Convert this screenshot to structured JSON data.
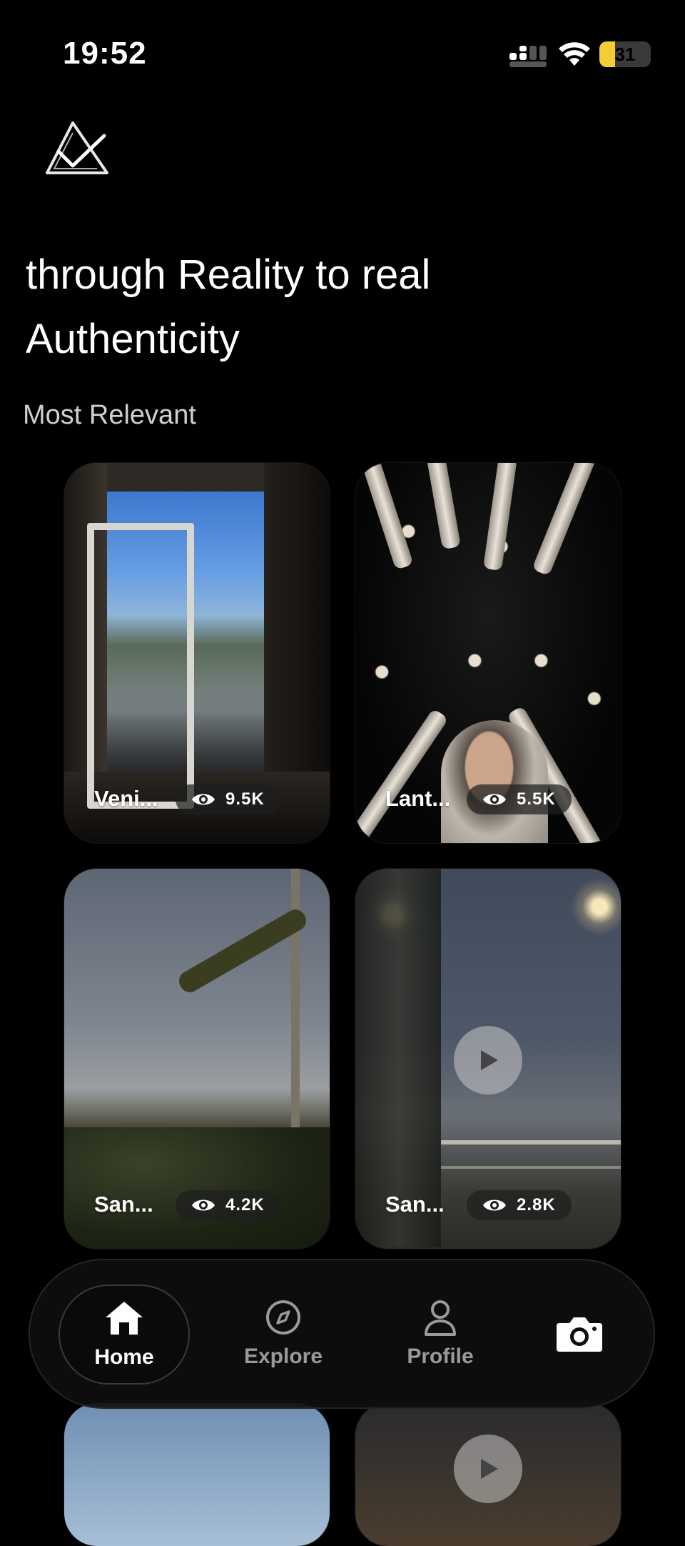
{
  "status_bar": {
    "time": "19:52",
    "battery_level": "31",
    "battery_fraction": 0.31,
    "icons": [
      "cellular-signal-icon",
      "wifi-icon",
      "battery-icon"
    ]
  },
  "header": {
    "logo": "app-logo",
    "headline_line1": "through Reality to real",
    "headline_line2": "Authenticity"
  },
  "section": {
    "title": "Most Relevant"
  },
  "cards": [
    {
      "label": "Veni...",
      "views": "9.5K",
      "is_video": false
    },
    {
      "label": "Lant...",
      "views": "5.5K",
      "is_video": false
    },
    {
      "label": "San...",
      "views": "4.2K",
      "is_video": false
    },
    {
      "label": "San...",
      "views": "2.8K",
      "is_video": true
    },
    {
      "label": "",
      "views": "",
      "is_video": false
    },
    {
      "label": "",
      "views": "",
      "is_video": true
    }
  ],
  "nav": {
    "home": "Home",
    "explore": "Explore",
    "profile": "Profile",
    "active": "home",
    "icons": {
      "home": "home-icon",
      "explore": "compass-icon",
      "profile": "person-icon",
      "camera": "camera-icon"
    }
  },
  "colors": {
    "background": "#000000",
    "battery": "#f4cc36",
    "text": "#ffffff",
    "muted": "#9a9a9a"
  }
}
